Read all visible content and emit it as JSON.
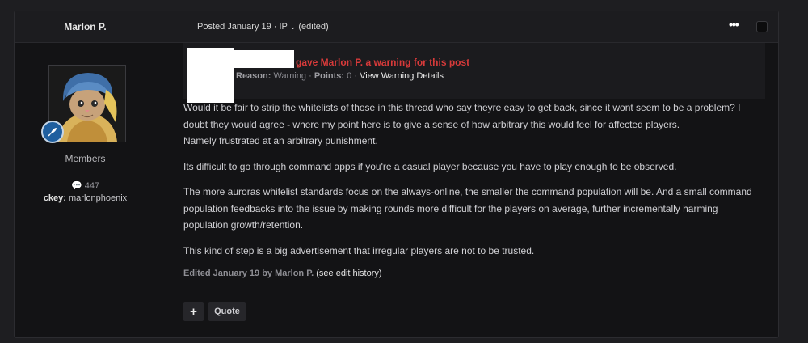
{
  "author": {
    "name": "Marlon P.",
    "group": "Members",
    "post_count": "447",
    "ckey_label": "ckey:",
    "ckey_value": "marlonphoenix"
  },
  "post_meta": {
    "posted": "Posted January 19 · IP",
    "edited_tag": "(edited)",
    "menu_glyph": "•••"
  },
  "warning": {
    "title": "gave Marlon P. a warning for this post",
    "reason_label": "Reason:",
    "reason_value": "Warning",
    "points_label": "Points:",
    "points_value": "0",
    "link": "View Warning Details"
  },
  "content": {
    "paragraphs": [
      "Would it be fair to strip the whitelists of those in this thread who say theyre easy to get back, since it wont seem to be a problem? I doubt they would agree - where my point here is to give a sense of how arbitrary this would feel for affected players.\nNamely frustrated at an arbitrary punishment.",
      "Its difficult to go through command apps if you're a casual player because you have to play enough to be observed.",
      "The more auroras whitelist standards focus on the always-online, the smaller the command population will be. And a small command population feedbacks into the issue by making rounds more difficult for the players on average, further incrementally harming population growth/retention.",
      "This kind of step is a big advertisement that irregular players are not to be trusted."
    ]
  },
  "edit": {
    "text": "Edited January 19 by Marlon P.",
    "history_link": "(see edit history)"
  },
  "actions": {
    "plus_label": "+",
    "quote_label": "Quote"
  },
  "icons": {
    "badge": "rocket-icon",
    "posts": "comment-icon"
  },
  "colors": {
    "warning_title": "#d83a3a",
    "badge_bg": "#1f5f9f"
  }
}
